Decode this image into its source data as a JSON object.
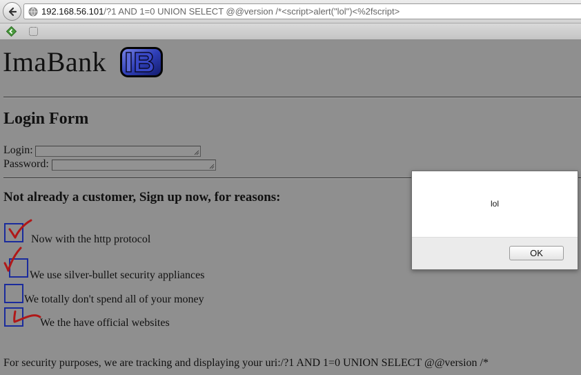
{
  "browser": {
    "url_host": "192.168.56.101",
    "url_rest": "/?1 AND 1=0 UNION SELECT @@version /*<script>alert(\"lol\")<%2fscript>"
  },
  "icons": {
    "back": "back-arrow-icon",
    "globe": "globe-icon",
    "extension": "extension-icon",
    "bookmark_page": "page-icon",
    "logo": "ib-logo-icon",
    "checkmark": "checkmark-icon"
  },
  "colors": {
    "page_bg": "#8f8f8f",
    "checkbox_border": "#1a2b9c",
    "checkmark": "#b01818"
  },
  "site": {
    "logo_text": "ImaBank",
    "login_heading": "Login Form",
    "login_label": "Login:",
    "password_label": "Password:",
    "signup_heading": "Not already a customer, Sign up now, for reasons:",
    "features": [
      {
        "text": "Now with the http protocol",
        "checked": true
      },
      {
        "text": "We use silver-bullet security appliances",
        "checked": true
      },
      {
        "text": "We totally don't spend all of your money",
        "checked": false
      },
      {
        "text": "We the have official websites",
        "checked": true
      }
    ],
    "footer": "For security purposes, we are tracking and displaying your uri:/?1 AND 1=0 UNION SELECT @@version /*"
  },
  "dialog": {
    "message": "lol",
    "ok_label": "OK"
  }
}
